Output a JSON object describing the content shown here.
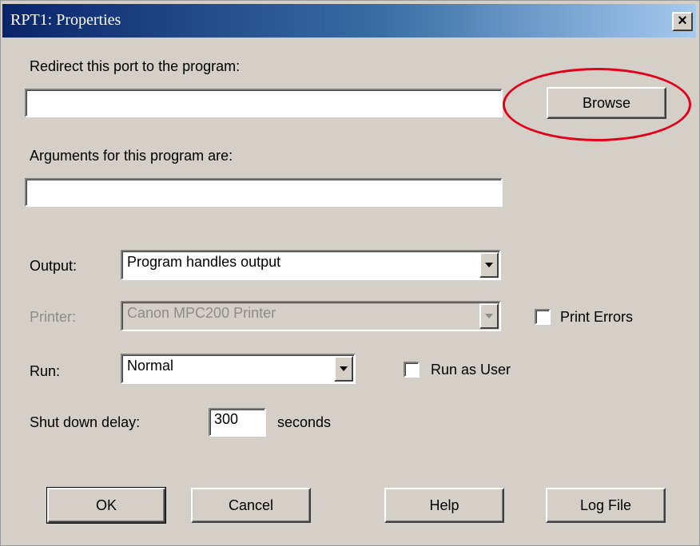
{
  "window": {
    "title": "RPT1: Properties",
    "close_glyph": "×"
  },
  "redirect": {
    "label": "Redirect this port to the program:",
    "value": "",
    "browse_label": "Browse"
  },
  "arguments": {
    "label": "Arguments for this program are:",
    "value": ""
  },
  "output": {
    "label": "Output:",
    "selected": "Program handles output"
  },
  "printer": {
    "label": "Printer:",
    "selected": "Canon MPC200 Printer",
    "enabled": false
  },
  "print_errors": {
    "label": "Print Errors",
    "checked": false
  },
  "run": {
    "label": "Run:",
    "selected": "Normal"
  },
  "run_as_user": {
    "label": "Run as User",
    "checked": false
  },
  "shutdown": {
    "label": "Shut down delay:",
    "value": "300",
    "unit": "seconds"
  },
  "buttons": {
    "ok": "OK",
    "cancel": "Cancel",
    "help": "Help",
    "log_file": "Log File"
  },
  "annotation": {
    "color": "#e3001b",
    "target": "browse-button"
  },
  "icons": {
    "close": "close-icon",
    "dropdown": "chevron-down-icon"
  }
}
